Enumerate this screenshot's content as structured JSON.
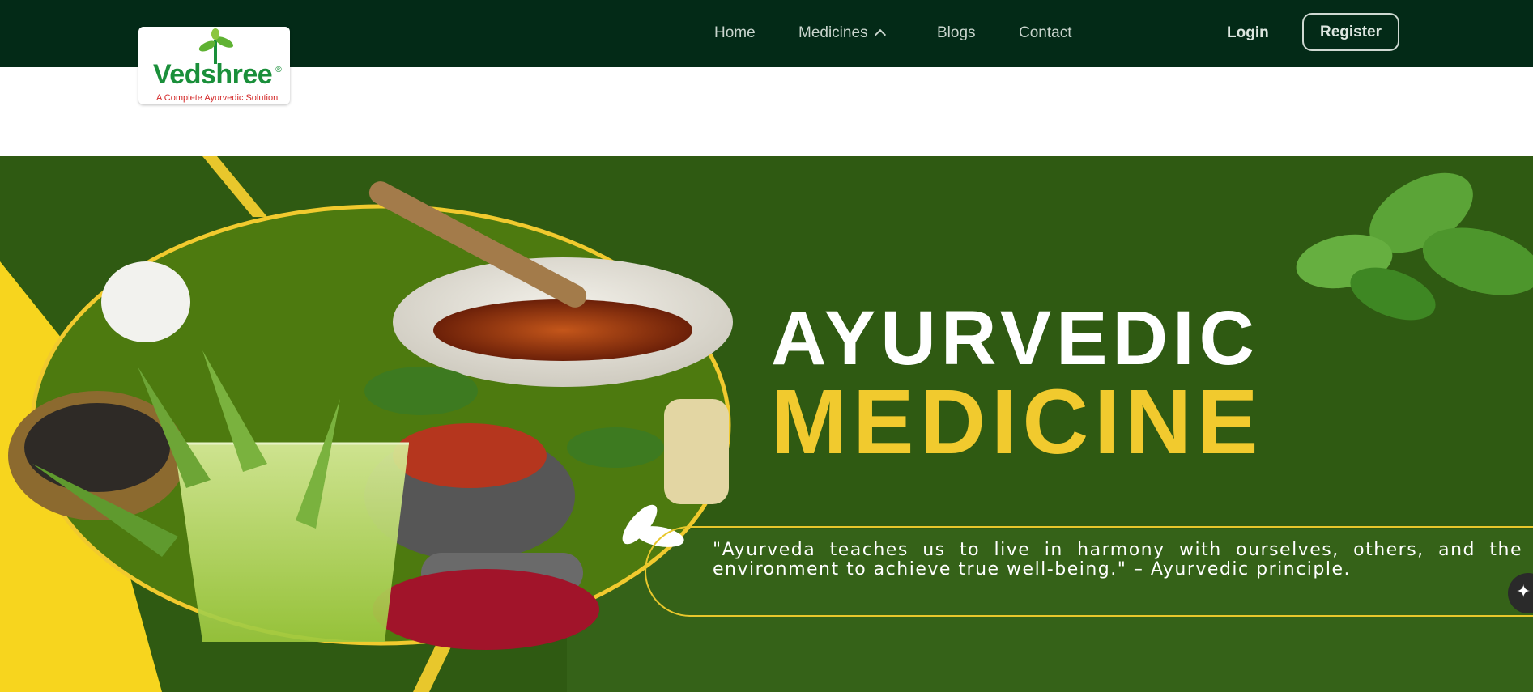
{
  "brand": {
    "name": "Vedshree",
    "registered_mark": "®",
    "tagline": "A Complete Ayurvedic Solution"
  },
  "nav": {
    "items": [
      {
        "label": "Home"
      },
      {
        "label": "Medicines"
      },
      {
        "label": "Blogs"
      },
      {
        "label": "Contact"
      }
    ],
    "login": "Login",
    "register": "Register"
  },
  "hero": {
    "title_line1": "AYURVEDIC",
    "title_line2": "MEDICINE",
    "quote": "\"Ayurveda teaches us to live in harmony with ourselves, others, and the environment to achieve true well-being.\" – Ayurvedic principle."
  },
  "icons": {
    "nav_dropdown": "chevron-up-icon",
    "fab": "sparkle-icon"
  },
  "colors": {
    "topbar": "#032a17",
    "hero_bg": "#2f5a12",
    "accent_yellow": "#f1ca2e",
    "brand_green": "#1a8f3a",
    "tagline_red": "#d42a2a"
  }
}
